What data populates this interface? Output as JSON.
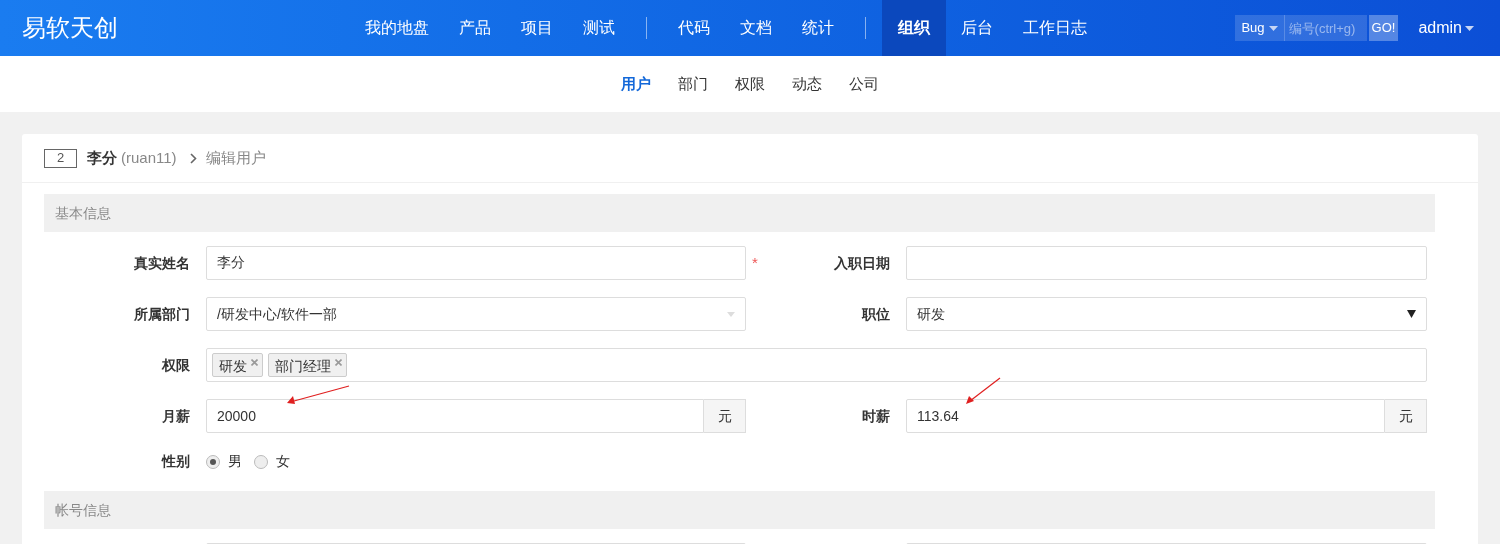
{
  "brand": "易软天创",
  "nav": {
    "groups": [
      [
        {
          "label": "我的地盘",
          "selected": false
        },
        {
          "label": "产品",
          "selected": false
        },
        {
          "label": "项目",
          "selected": false
        },
        {
          "label": "测试",
          "selected": false
        }
      ],
      [
        {
          "label": "代码",
          "selected": false
        },
        {
          "label": "文档",
          "selected": false
        },
        {
          "label": "统计",
          "selected": false
        }
      ],
      [
        {
          "label": "组织",
          "selected": true
        },
        {
          "label": "后台",
          "selected": false
        },
        {
          "label": "工作日志",
          "selected": false
        }
      ]
    ]
  },
  "search": {
    "type": "Bug",
    "placeholder": "编号(ctrl+g)",
    "button": "GO!"
  },
  "user": "admin",
  "subnav": [
    {
      "label": "用户",
      "selected": true
    },
    {
      "label": "部门",
      "selected": false
    },
    {
      "label": "权限",
      "selected": false
    },
    {
      "label": "动态",
      "selected": false
    },
    {
      "label": "公司",
      "selected": false
    }
  ],
  "breadcrumb": {
    "id": "2",
    "name": "李分",
    "account": "(ruan11)",
    "page": "编辑用户"
  },
  "sections": [
    {
      "title": "基本信息",
      "rows": [
        {
          "fields": [
            {
              "kind": "text",
              "label": "真实姓名",
              "value": "李分",
              "mark": "*"
            },
            {
              "kind": "text",
              "label": "入职日期"
            }
          ]
        },
        {
          "fields": [
            {
              "kind": "chosen",
              "label": "所属部门",
              "value": "/研发中心/软件一部"
            },
            {
              "kind": "select",
              "label": "职位",
              "value": "研发"
            }
          ]
        },
        {
          "fields": [
            {
              "kind": "tags",
              "label": "权限",
              "tags": [
                "研发",
                "部门经理"
              ]
            }
          ]
        },
        {
          "fields": [
            {
              "kind": "addon",
              "label": "月薪",
              "value": "20000",
              "addon": "元",
              "annotated": true
            },
            {
              "kind": "addon",
              "label": "时薪",
              "value": "113.64",
              "addon": "元",
              "annotated": true
            }
          ]
        },
        {
          "fields": [
            {
              "kind": "radio",
              "label": "性别",
              "options": [
                {
                  "label": "男",
                  "selected": true
                },
                {
                  "label": "女",
                  "selected": false
                }
              ]
            }
          ]
        }
      ]
    },
    {
      "title": "帐号信息",
      "rows": [
        {
          "fields": [
            {
              "kind": "text"
            },
            {
              "kind": "text"
            }
          ]
        }
      ]
    }
  ]
}
